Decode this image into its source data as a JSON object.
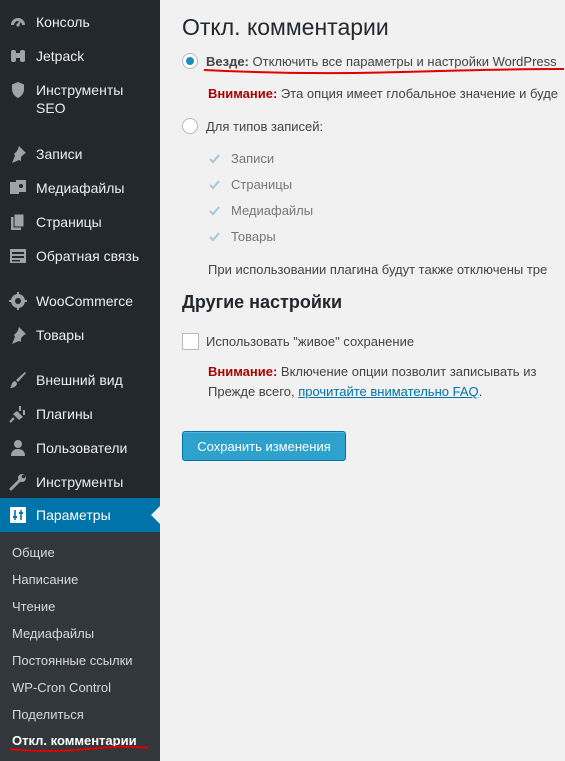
{
  "sidebar": {
    "items": [
      {
        "label": "Консоль",
        "icon": "dashboard-icon"
      },
      {
        "label": "Jetpack",
        "icon": "jetpack-icon"
      },
      {
        "label": "Инструменты SEO",
        "icon": "seo-shield-icon"
      },
      {
        "label": "Записи",
        "icon": "pin-icon"
      },
      {
        "label": "Медиафайлы",
        "icon": "media-icon"
      },
      {
        "label": "Страницы",
        "icon": "pages-icon"
      },
      {
        "label": "Обратная связь",
        "icon": "feedback-icon"
      },
      {
        "label": "WooCommerce",
        "icon": "woocommerce-icon"
      },
      {
        "label": "Товары",
        "icon": "pin-icon"
      },
      {
        "label": "Внешний вид",
        "icon": "brush-icon"
      },
      {
        "label": "Плагины",
        "icon": "plugin-icon"
      },
      {
        "label": "Пользователи",
        "icon": "users-icon"
      },
      {
        "label": "Инструменты",
        "icon": "wrench-icon"
      },
      {
        "label": "Параметры",
        "icon": "settings-icon"
      }
    ],
    "submenu": [
      "Общие",
      "Написание",
      "Чтение",
      "Медиафайлы",
      "Постоянные ссылки",
      "WP-Cron Control",
      "Поделиться",
      "Откл. комментарии"
    ],
    "seo_line2": "SEO"
  },
  "main": {
    "title": "Откл. комментарии",
    "everywhere_label": "Везде:",
    "everywhere_text": " Отключить все параметры и настройки WordPress",
    "warning_label": "Внимание:",
    "everywhere_warning": " Эта опция имеет глобальное значение и буде",
    "post_types_label": "Для типов записей:",
    "post_types": [
      "Записи",
      "Страницы",
      "Медиафайлы",
      "Товары"
    ],
    "post_types_note": "При использовании плагина будут также отключены тре",
    "other_settings_heading": "Другие настройки",
    "live_save_label": "Использовать \"живое\" сохранение",
    "live_warning": " Включение опции позволит записывать из",
    "faq_prefix": "Прежде всего, ",
    "faq_link": "прочитайте внимательно FAQ",
    "faq_suffix": ".",
    "save_button": "Сохранить изменения"
  },
  "colors": {
    "sidebar_bg": "#23282d",
    "active_bg": "#0073aa",
    "link": "#0073aa",
    "warning": "#aa0000",
    "button": "#2ea2cc",
    "annotation_red": "#e00000"
  }
}
